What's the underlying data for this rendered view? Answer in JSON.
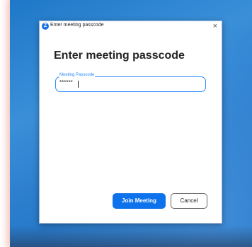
{
  "window": {
    "title": "Enter meeting passcode",
    "app_icon_glyph": "Z",
    "close_glyph": "×"
  },
  "main": {
    "heading": "Enter meeting passcode",
    "passcode_label": "Meeting Passcode",
    "passcode_value": "******"
  },
  "actions": {
    "join_label": "Join Meeting",
    "cancel_label": "Cancel"
  },
  "colors": {
    "accent": "#0e72ed",
    "background_blue": "#2a7ccc"
  }
}
